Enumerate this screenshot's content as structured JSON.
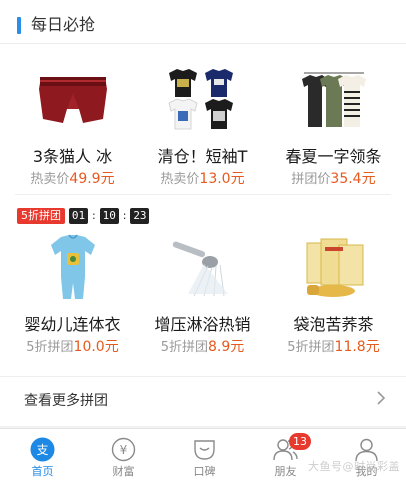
{
  "section": {
    "title": "每日必抢"
  },
  "daily_products": [
    {
      "name": "3条猫人 冰",
      "price_label": "热卖价",
      "price": "49.9元",
      "icon": "underwear-image"
    },
    {
      "name": "清仓！短袖T",
      "price_label": "热卖价",
      "price": "13.0元",
      "icon": "tshirts-image"
    },
    {
      "name": "春夏一字领条",
      "price_label": "拼团价",
      "price": "35.4元",
      "icon": "striped-shirts-image"
    }
  ],
  "group_buy": {
    "tag": "5折拼团",
    "timer": {
      "hours": "01",
      "minutes": "10",
      "seconds": "23"
    }
  },
  "group_products": [
    {
      "name": "婴幼儿连体衣",
      "price_label": "5折拼团",
      "price": "10.0元",
      "icon": "baby-onesie-image"
    },
    {
      "name": "增压淋浴热销",
      "price_label": "5折拼团",
      "price": "8.9元",
      "icon": "shower-head-image"
    },
    {
      "name": "袋泡苦荞茶",
      "price_label": "5折拼团",
      "price": "11.8元",
      "icon": "tea-bags-image"
    }
  ],
  "more": {
    "label": "查看更多拼团"
  },
  "tabbar": {
    "items": [
      {
        "label": "首页",
        "icon": "alipay-icon",
        "active": true
      },
      {
        "label": "财富",
        "icon": "wealth-icon"
      },
      {
        "label": "口碑",
        "icon": "koubei-icon"
      },
      {
        "label": "朋友",
        "icon": "friends-icon",
        "badge": "13"
      },
      {
        "label": "我的",
        "icon": "profile-icon"
      }
    ]
  },
  "colors": {
    "accent": "#1e88e5",
    "price": "#e55a1f",
    "tag": "#e8392f",
    "header_bar": "#2a8ee8"
  },
  "watermark": "大鱼号@时尚彩盖"
}
